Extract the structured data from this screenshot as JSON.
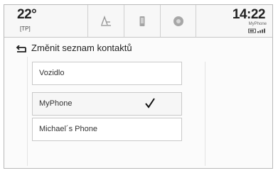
{
  "status": {
    "temperature": "22°",
    "temp_sub": "[TP]",
    "time": "14:22",
    "network": "MyPhone"
  },
  "tabs": [
    {
      "icon": "music-icon"
    },
    {
      "icon": "phone-icon"
    },
    {
      "icon": "settings-icon"
    }
  ],
  "header": {
    "title": "Změnit seznam kontaktů",
    "back_icon": "back-arrow-icon"
  },
  "contacts": [
    {
      "label": "Vozidlo",
      "checked": false
    },
    {
      "label": "MyPhone",
      "checked": true
    },
    {
      "label": "Michael´s Phone",
      "checked": false
    }
  ],
  "colors": {
    "border": "#c9c9c9",
    "text": "#222222"
  }
}
